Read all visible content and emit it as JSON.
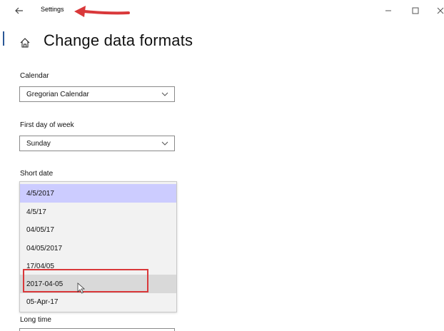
{
  "window": {
    "title": "Settings",
    "controls": [
      "minimize-icon",
      "maximize-icon",
      "close-icon"
    ]
  },
  "page": {
    "title": "Change data formats"
  },
  "calendar": {
    "label": "Calendar",
    "value": "Gregorian Calendar"
  },
  "first_day": {
    "label": "First day of week",
    "value": "Sunday"
  },
  "short_date": {
    "label": "Short date",
    "options": [
      "4/5/2017",
      "4/5/17",
      "04/05/17",
      "04/05/2017",
      "17/04/05",
      "2017-04-05",
      "05-Apr-17"
    ],
    "selected": "4/5/2017",
    "hovered": "2017-04-05"
  },
  "long_time": {
    "label": "Long time"
  },
  "colors": {
    "selected_bg": "#ccccff",
    "hover_bg": "#d9d9d9",
    "annotation_red": "#d9383a",
    "accent": "#2b5797"
  }
}
